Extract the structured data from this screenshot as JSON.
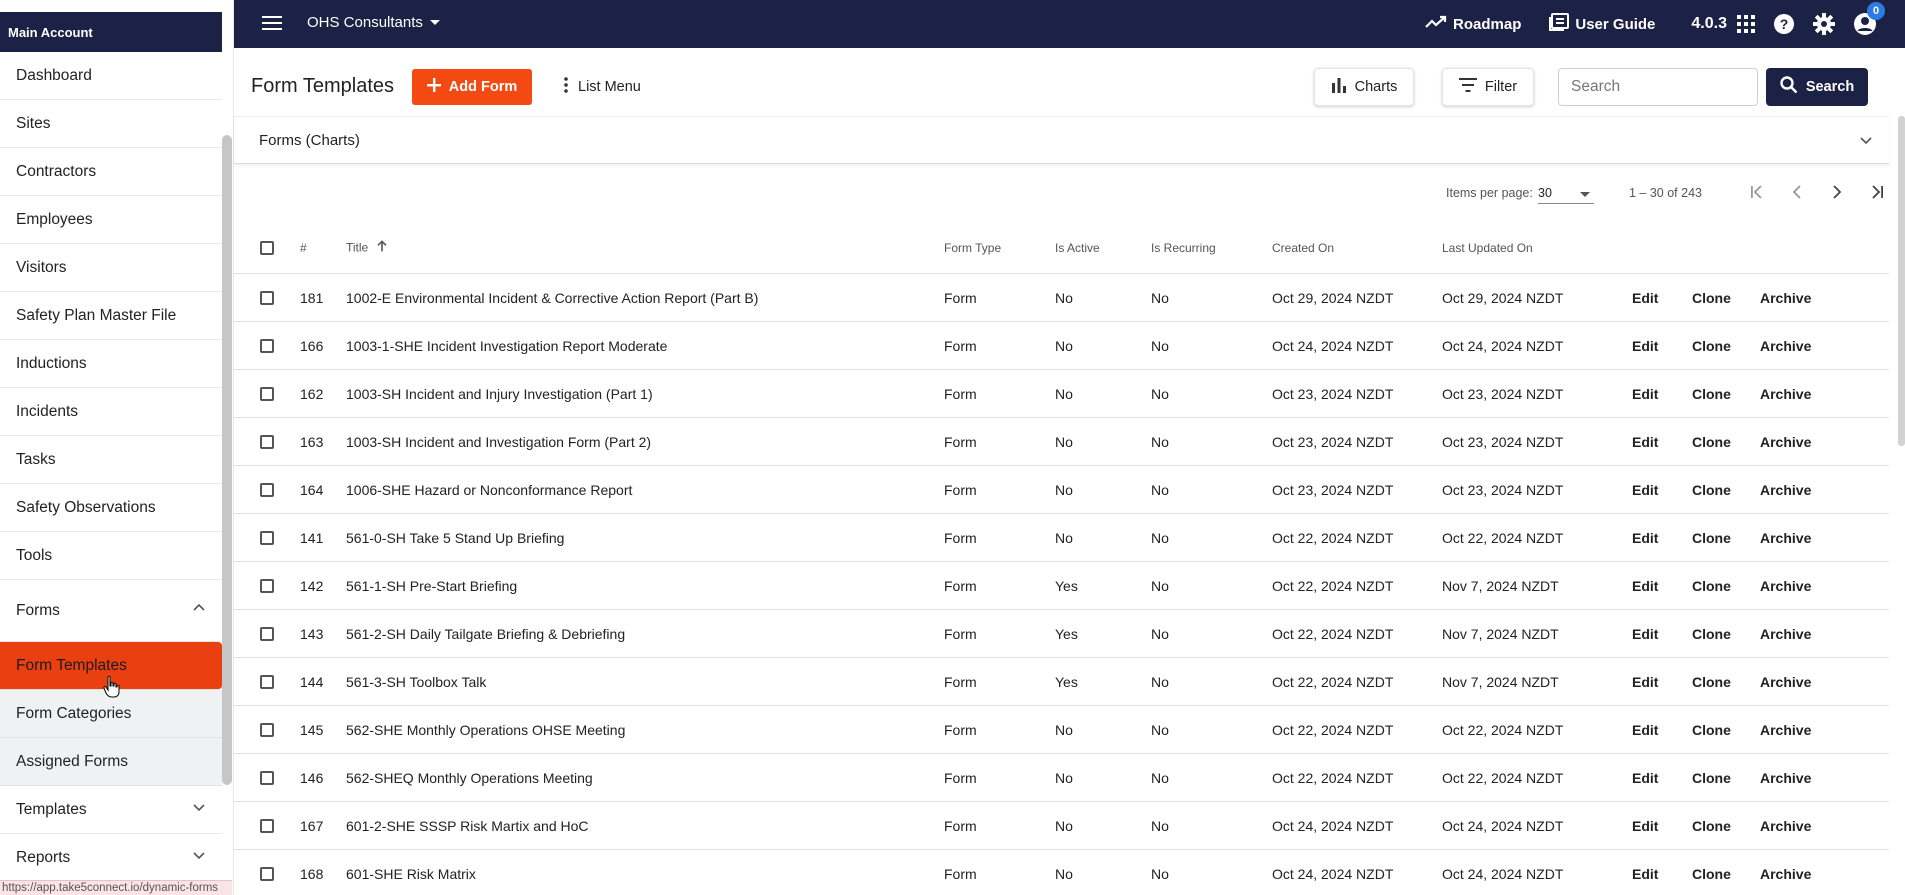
{
  "sidebar": {
    "account": "Main Account",
    "items": [
      {
        "label": "Dashboard"
      },
      {
        "label": "Sites"
      },
      {
        "label": "Contractors"
      },
      {
        "label": "Employees"
      },
      {
        "label": "Visitors"
      },
      {
        "label": "Safety Plan Master File"
      },
      {
        "label": "Inductions"
      },
      {
        "label": "Incidents"
      },
      {
        "label": "Tasks"
      },
      {
        "label": "Safety Observations"
      },
      {
        "label": "Tools"
      }
    ],
    "forms": {
      "label": "Forms",
      "sub": [
        {
          "label": "Form Templates"
        },
        {
          "label": "Form Categories"
        },
        {
          "label": "Assigned Forms"
        }
      ]
    },
    "templates": "Templates",
    "reports": "Reports",
    "active_color": "#ea3f11"
  },
  "status_url": "https://app.take5connect.io/dynamic-forms",
  "topbar": {
    "company": "OHS Consultants",
    "roadmap": "Roadmap",
    "user_guide": "User Guide",
    "version": "4.0.3",
    "notification_count": "0",
    "bg_color": "#1b2245"
  },
  "toolbar": {
    "title": "Form Templates",
    "add_label": "Add Form",
    "list_menu_label": "List Menu",
    "charts_label": "Charts",
    "filter_label": "Filter",
    "search_placeholder": "Search",
    "search_button": "Search",
    "accent_color": "#f24a12"
  },
  "charts_panel": {
    "label": "Forms (Charts)"
  },
  "paginator": {
    "items_per_page_label": "Items per page:",
    "items_per_page": "30",
    "range": "1 – 30 of 243"
  },
  "table": {
    "headers": {
      "num": "#",
      "title": "Title",
      "form_type": "Form Type",
      "is_active": "Is Active",
      "is_recurring": "Is Recurring",
      "created_on": "Created On",
      "last_updated_on": "Last Updated On"
    },
    "actions": {
      "edit": "Edit",
      "clone": "Clone",
      "archive": "Archive"
    },
    "rows": [
      {
        "num": "181",
        "title": "1002-E Environmental Incident & Corrective Action Report (Part B)",
        "form_type": "Form",
        "is_active": "No",
        "is_recurring": "No",
        "created_on": "Oct 29, 2024 NZDT",
        "last_updated_on": "Oct 29, 2024 NZDT"
      },
      {
        "num": "166",
        "title": "1003-1-SHE Incident Investigation Report Moderate",
        "form_type": "Form",
        "is_active": "No",
        "is_recurring": "No",
        "created_on": "Oct 24, 2024 NZDT",
        "last_updated_on": "Oct 24, 2024 NZDT"
      },
      {
        "num": "162",
        "title": "1003-SH Incident and Injury Investigation (Part 1)",
        "form_type": "Form",
        "is_active": "No",
        "is_recurring": "No",
        "created_on": "Oct 23, 2024 NZDT",
        "last_updated_on": "Oct 23, 2024 NZDT"
      },
      {
        "num": "163",
        "title": "1003-SH Incident and Investigation Form (Part 2)",
        "form_type": "Form",
        "is_active": "No",
        "is_recurring": "No",
        "created_on": "Oct 23, 2024 NZDT",
        "last_updated_on": "Oct 23, 2024 NZDT"
      },
      {
        "num": "164",
        "title": "1006-SHE Hazard or Nonconformance Report",
        "form_type": "Form",
        "is_active": "No",
        "is_recurring": "No",
        "created_on": "Oct 23, 2024 NZDT",
        "last_updated_on": "Oct 23, 2024 NZDT"
      },
      {
        "num": "141",
        "title": "561-0-SH Take 5 Stand Up Briefing",
        "form_type": "Form",
        "is_active": "No",
        "is_recurring": "No",
        "created_on": "Oct 22, 2024 NZDT",
        "last_updated_on": "Oct 22, 2024 NZDT"
      },
      {
        "num": "142",
        "title": "561-1-SH Pre-Start Briefing",
        "form_type": "Form",
        "is_active": "Yes",
        "is_recurring": "No",
        "created_on": "Oct 22, 2024 NZDT",
        "last_updated_on": "Nov 7, 2024 NZDT"
      },
      {
        "num": "143",
        "title": "561-2-SH Daily Tailgate Briefing & Debriefing",
        "form_type": "Form",
        "is_active": "Yes",
        "is_recurring": "No",
        "created_on": "Oct 22, 2024 NZDT",
        "last_updated_on": "Nov 7, 2024 NZDT"
      },
      {
        "num": "144",
        "title": "561-3-SH Toolbox Talk",
        "form_type": "Form",
        "is_active": "Yes",
        "is_recurring": "No",
        "created_on": "Oct 22, 2024 NZDT",
        "last_updated_on": "Nov 7, 2024 NZDT"
      },
      {
        "num": "145",
        "title": "562-SHE Monthly Operations OHSE Meeting",
        "form_type": "Form",
        "is_active": "No",
        "is_recurring": "No",
        "created_on": "Oct 22, 2024 NZDT",
        "last_updated_on": "Oct 22, 2024 NZDT"
      },
      {
        "num": "146",
        "title": "562-SHEQ Monthly Operations Meeting",
        "form_type": "Form",
        "is_active": "No",
        "is_recurring": "No",
        "created_on": "Oct 22, 2024 NZDT",
        "last_updated_on": "Oct 22, 2024 NZDT"
      },
      {
        "num": "167",
        "title": "601-2-SHE SSSP Risk Martix and HoC",
        "form_type": "Form",
        "is_active": "No",
        "is_recurring": "No",
        "created_on": "Oct 24, 2024 NZDT",
        "last_updated_on": "Oct 24, 2024 NZDT"
      },
      {
        "num": "168",
        "title": "601-SHE Risk Matrix",
        "form_type": "Form",
        "is_active": "No",
        "is_recurring": "No",
        "created_on": "Oct 24, 2024 NZDT",
        "last_updated_on": "Oct 24, 2024 NZDT"
      }
    ]
  }
}
